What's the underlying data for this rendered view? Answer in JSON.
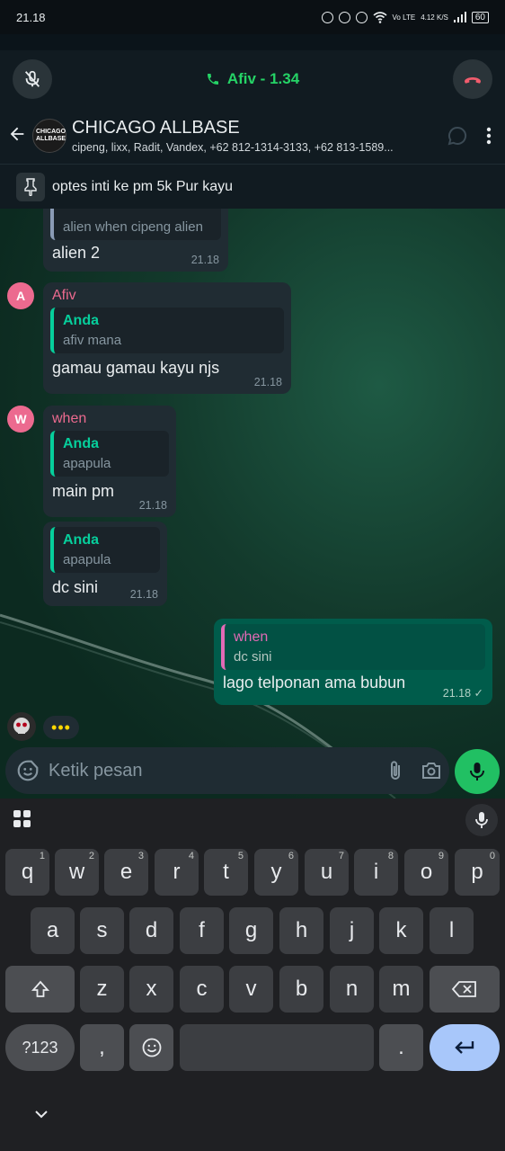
{
  "status": {
    "time": "21.18",
    "network": "Vo LTE",
    "speed": "4.12 K/S",
    "battery": "60"
  },
  "call": {
    "title": "Afiv - 1.34"
  },
  "header": {
    "title": "CHICAGO ALLBASE",
    "avatar_text": "CHICAGO ALLBASE",
    "subtitle": "cipeng, lixx, Radit, Vandex, +62 812-1314-3133, +62 813-1589..."
  },
  "pinned": {
    "text": "optes inti ke pm 5k Pur kayu"
  },
  "messages": [
    {
      "quote_text": "alien when cipeng alien",
      "text": "alien 2",
      "time": "21.18"
    },
    {
      "avatar": "A",
      "sender": "Afiv",
      "quote_author": "Anda",
      "quote_text": "afiv mana",
      "text": "gamau gamau kayu njs",
      "time": "21.18"
    },
    {
      "avatar": "W",
      "sender": "when",
      "quote_author": "Anda",
      "quote_text": "apapula",
      "text": "main pm",
      "time": "21.18"
    },
    {
      "quote_author": "Anda",
      "quote_text": "apapula",
      "text": "dc sini",
      "time": "21.18"
    },
    {
      "quote_author": "when",
      "quote_text": "dc sini",
      "text": "lago telponan ama bubun",
      "time": "21.18 ✓"
    }
  ],
  "typing": "•••",
  "composer": {
    "placeholder": "Ketik pesan"
  },
  "keyboard": {
    "row1": [
      {
        "k": "q",
        "h": "1"
      },
      {
        "k": "w",
        "h": "2"
      },
      {
        "k": "e",
        "h": "3"
      },
      {
        "k": "r",
        "h": "4"
      },
      {
        "k": "t",
        "h": "5"
      },
      {
        "k": "y",
        "h": "6"
      },
      {
        "k": "u",
        "h": "7"
      },
      {
        "k": "i",
        "h": "8"
      },
      {
        "k": "o",
        "h": "9"
      },
      {
        "k": "p",
        "h": "0"
      }
    ],
    "row2": [
      "a",
      "s",
      "d",
      "f",
      "g",
      "h",
      "j",
      "k",
      "l"
    ],
    "row3": [
      "z",
      "x",
      "c",
      "v",
      "b",
      "n",
      "m"
    ],
    "symbols": "?123",
    "comma": ",",
    "period": "."
  }
}
